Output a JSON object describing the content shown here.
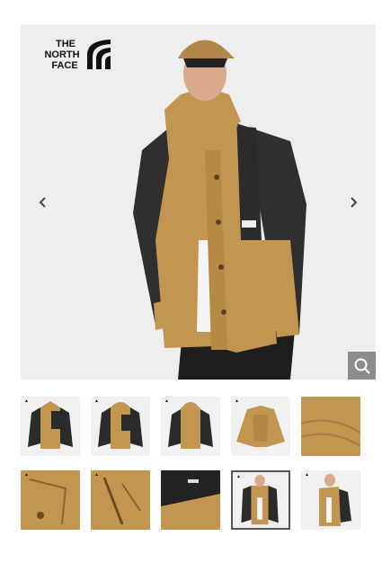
{
  "brand": {
    "logo_line1": "THE",
    "logo_line2": "NORTH",
    "logo_line3": "FACE"
  },
  "gallery": {
    "prev_icon": "chevron-left-icon",
    "next_icon": "chevron-right-icon",
    "zoom_icon": "magnifier-icon",
    "selected_index": 8,
    "thumbnails": [
      {
        "subject": "jacket-front"
      },
      {
        "subject": "jacket-front-hood"
      },
      {
        "subject": "jacket-back"
      },
      {
        "subject": "jacket-open-lining"
      },
      {
        "subject": "fabric-closeup"
      },
      {
        "subject": "pocket-closeup"
      },
      {
        "subject": "zipper-closeup"
      },
      {
        "subject": "cuff-closeup"
      },
      {
        "subject": "model-front"
      },
      {
        "subject": "model-side"
      }
    ]
  },
  "colors": {
    "tan": "#c29650",
    "black": "#2b2b2b",
    "background": "#eeeeee",
    "zoom_bg": "#8c8c8c"
  }
}
